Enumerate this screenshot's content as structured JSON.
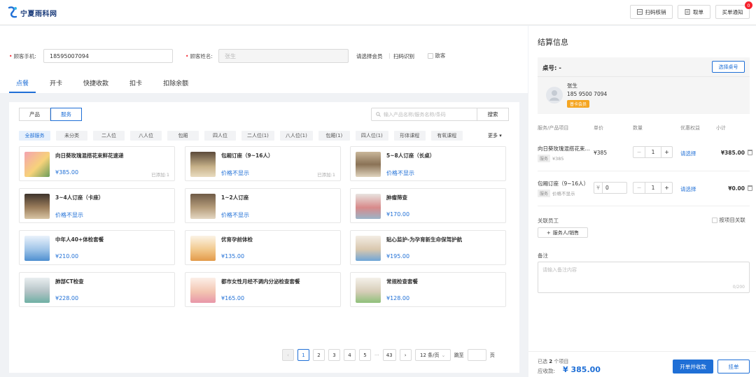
{
  "brand": {
    "name": "宁夏雨科网",
    "color": "#1f6fd6"
  },
  "topbar": {
    "scan_label": "扫码核销",
    "pickup_label": "取单",
    "notify_label": "买单通知",
    "notify_count": "0"
  },
  "form": {
    "phone_label": "顾客手机:",
    "phone_value": "18595007094",
    "name_label": "顾客姓名:",
    "name_placeholder": "张生",
    "select_member": "请选择会员",
    "scan_identify": "扫码识别",
    "walk_in": "散客"
  },
  "tabs": [
    {
      "label": "点餐"
    },
    {
      "label": "开卡"
    },
    {
      "label": "快捷收款"
    },
    {
      "label": "扣卡"
    },
    {
      "label": "扣除余额"
    }
  ],
  "catalog": {
    "seg_product": "产品",
    "seg_service": "服务",
    "search_placeholder": "输入产品名称/服务名称/条码",
    "search_button": "搜索",
    "more": "更多",
    "chips": [
      "全部服务",
      "未分类",
      "二人位",
      "八人位",
      "包厢",
      "四人位",
      "二人位(1)",
      "八人位(1)",
      "包厢(1)",
      "四人位(1)",
      "形体课程",
      "有氧课程"
    ],
    "items": [
      {
        "name": "向日葵玫瑰混搭花束鲜花速递",
        "price": "¥385.00",
        "added": "已添加:1"
      },
      {
        "name": "包厢订座（9~16人）",
        "price": "价格不显示",
        "added": "已添加:1"
      },
      {
        "name": "5~8人订座（长桌）",
        "price": "价格不显示",
        "added": ""
      },
      {
        "name": "3~4人订座（卡座）",
        "price": "价格不显示",
        "added": ""
      },
      {
        "name": "1~2人订座",
        "price": "价格不显示",
        "added": ""
      },
      {
        "name": "肿瘤筛查",
        "price": "¥170.00",
        "added": ""
      },
      {
        "name": "中年人40+体检套餐",
        "price": "¥210.00",
        "added": ""
      },
      {
        "name": "优育孕前体检",
        "price": "¥135.00",
        "added": ""
      },
      {
        "name": "贴心监护-为孕育新生命保驾护航",
        "price": "¥195.00",
        "added": ""
      },
      {
        "name": "肺部CT检查",
        "price": "¥228.00",
        "added": ""
      },
      {
        "name": "都市女性月经不调内分泌检查套餐",
        "price": "¥165.00",
        "added": ""
      },
      {
        "name": "常规检查套餐",
        "price": "¥128.00",
        "added": ""
      }
    ],
    "pager": {
      "pages": [
        "1",
        "2",
        "3",
        "4",
        "5"
      ],
      "ellipsis": "···",
      "last": "43",
      "page_size": "12 条/页",
      "goto_label": "跳至",
      "page_unit": "页"
    }
  },
  "checkout": {
    "title": "结算信息",
    "table_label": "桌号:",
    "table_value": "-",
    "select_table": "选择桌号",
    "customer_name": "张生",
    "customer_phone": "185 9500 7094",
    "member_badge": "普卡会员",
    "headers": {
      "item": "服务/产品项目",
      "price": "单价",
      "qty": "数量",
      "discount": "优惠权益",
      "subtotal": "小计"
    },
    "rows": [
      {
        "name": "向日葵玫瑰混搭花束...",
        "tag": "服务",
        "orig": "¥385",
        "price": "¥385",
        "qty": "1",
        "discount": "请选择",
        "subtotal": "¥385.00"
      },
      {
        "name": "包厢订座（9~16人）",
        "tag": "服务",
        "orig": "价格不显示",
        "price_prefix": "¥",
        "price": "0",
        "qty": "1",
        "discount": "请选择",
        "subtotal": "¥0.00"
      }
    ],
    "staff_label": "关联员工",
    "by_item_label": "按项目关联",
    "add_staff": "服务人/销售",
    "note_label": "备注",
    "note_placeholder": "请输入备注内容",
    "note_count": "0/200",
    "selected_prefix": "已选",
    "selected_count": "2",
    "selected_suffix": "个项目",
    "due_label": "应收款:",
    "due_amount": "¥ 385.00",
    "submit_label": "开单并收款",
    "hold_label": "挂单"
  }
}
